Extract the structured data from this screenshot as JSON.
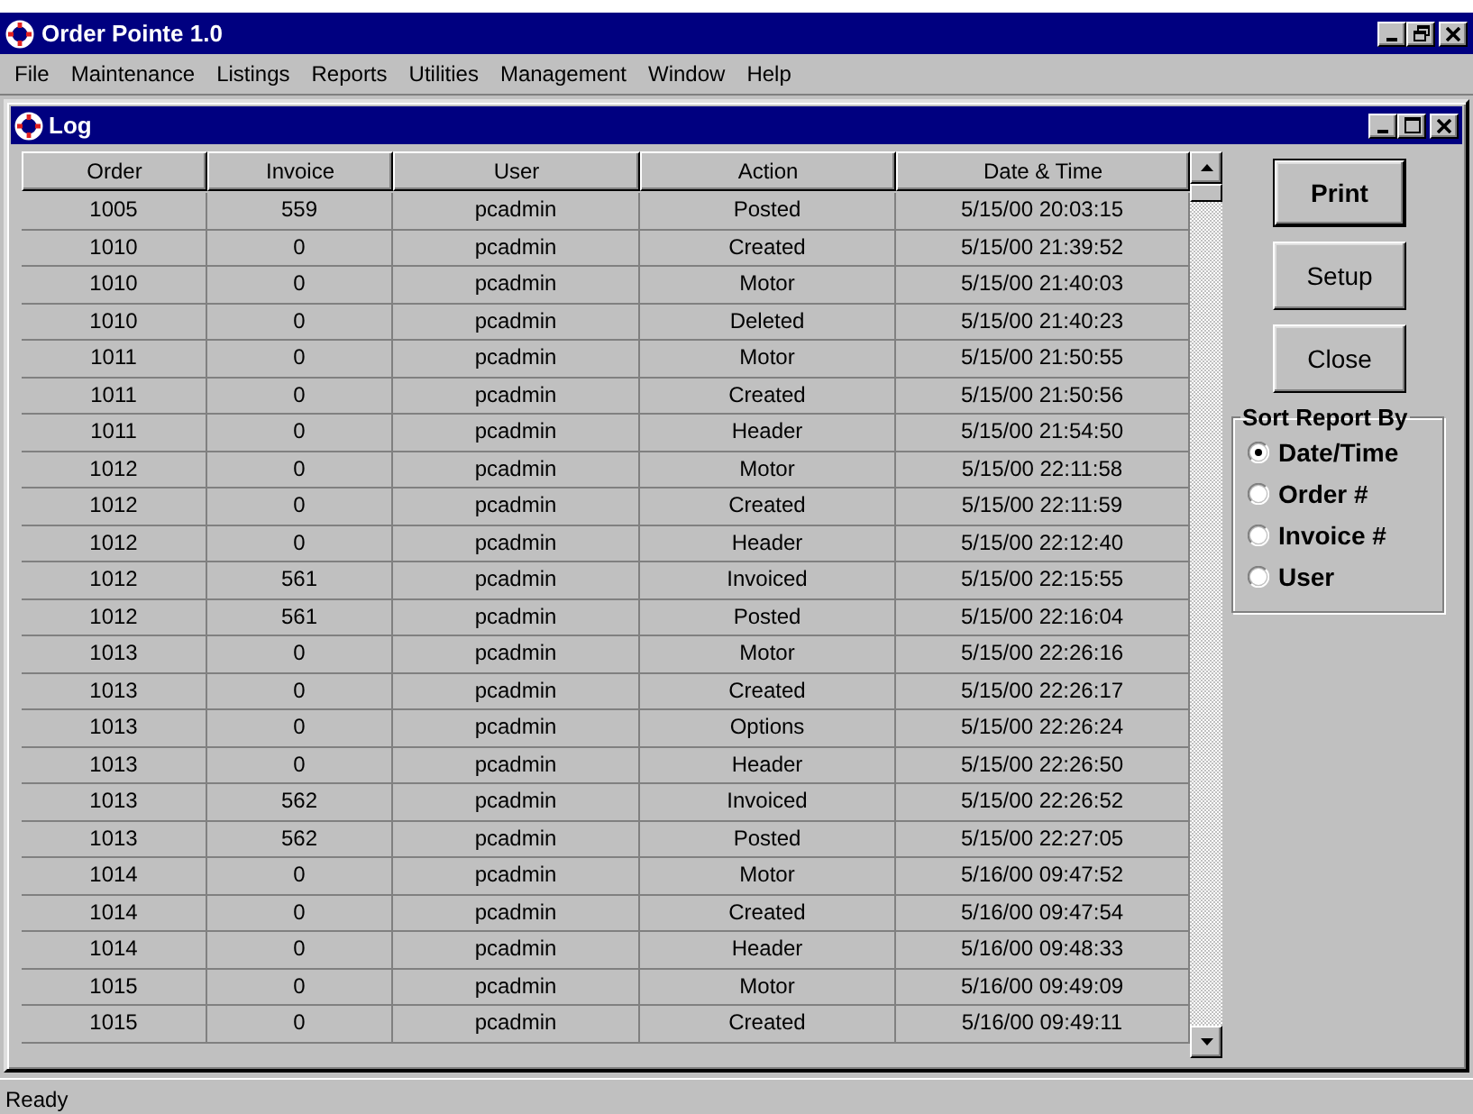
{
  "window": {
    "title": "Order Pointe 1.0"
  },
  "menu": [
    "File",
    "Maintenance",
    "Listings",
    "Reports",
    "Utilities",
    "Management",
    "Window",
    "Help"
  ],
  "child_window": {
    "title": "Log"
  },
  "table": {
    "columns": [
      "Order",
      "Invoice",
      "User",
      "Action",
      "Date & Time"
    ],
    "rows": [
      [
        "1005",
        "559",
        "pcadmin",
        "Posted",
        "5/15/00 20:03:15"
      ],
      [
        "1010",
        "0",
        "pcadmin",
        "Created",
        "5/15/00 21:39:52"
      ],
      [
        "1010",
        "0",
        "pcadmin",
        "Motor",
        "5/15/00 21:40:03"
      ],
      [
        "1010",
        "0",
        "pcadmin",
        "Deleted",
        "5/15/00 21:40:23"
      ],
      [
        "1011",
        "0",
        "pcadmin",
        "Motor",
        "5/15/00 21:50:55"
      ],
      [
        "1011",
        "0",
        "pcadmin",
        "Created",
        "5/15/00 21:50:56"
      ],
      [
        "1011",
        "0",
        "pcadmin",
        "Header",
        "5/15/00 21:54:50"
      ],
      [
        "1012",
        "0",
        "pcadmin",
        "Motor",
        "5/15/00 22:11:58"
      ],
      [
        "1012",
        "0",
        "pcadmin",
        "Created",
        "5/15/00 22:11:59"
      ],
      [
        "1012",
        "0",
        "pcadmin",
        "Header",
        "5/15/00 22:12:40"
      ],
      [
        "1012",
        "561",
        "pcadmin",
        "Invoiced",
        "5/15/00 22:15:55"
      ],
      [
        "1012",
        "561",
        "pcadmin",
        "Posted",
        "5/15/00 22:16:04"
      ],
      [
        "1013",
        "0",
        "pcadmin",
        "Motor",
        "5/15/00 22:26:16"
      ],
      [
        "1013",
        "0",
        "pcadmin",
        "Created",
        "5/15/00 22:26:17"
      ],
      [
        "1013",
        "0",
        "pcadmin",
        "Options",
        "5/15/00 22:26:24"
      ],
      [
        "1013",
        "0",
        "pcadmin",
        "Header",
        "5/15/00 22:26:50"
      ],
      [
        "1013",
        "562",
        "pcadmin",
        "Invoiced",
        "5/15/00 22:26:52"
      ],
      [
        "1013",
        "562",
        "pcadmin",
        "Posted",
        "5/15/00 22:27:05"
      ],
      [
        "1014",
        "0",
        "pcadmin",
        "Motor",
        "5/16/00 09:47:52"
      ],
      [
        "1014",
        "0",
        "pcadmin",
        "Created",
        "5/16/00 09:47:54"
      ],
      [
        "1014",
        "0",
        "pcadmin",
        "Header",
        "5/16/00 09:48:33"
      ],
      [
        "1015",
        "0",
        "pcadmin",
        "Motor",
        "5/16/00 09:49:09"
      ],
      [
        "1015",
        "0",
        "pcadmin",
        "Created",
        "5/16/00 09:49:11"
      ]
    ]
  },
  "buttons": [
    {
      "label": "Print",
      "default": true
    },
    {
      "label": "Setup",
      "default": false
    },
    {
      "label": "Close",
      "default": false
    }
  ],
  "sort_group": {
    "title": "Sort Report By",
    "options": [
      {
        "label": "Date/Time",
        "selected": true
      },
      {
        "label": "Order #",
        "selected": false
      },
      {
        "label": "Invoice #",
        "selected": false
      },
      {
        "label": "User",
        "selected": false
      }
    ]
  },
  "status_bar": "Ready"
}
